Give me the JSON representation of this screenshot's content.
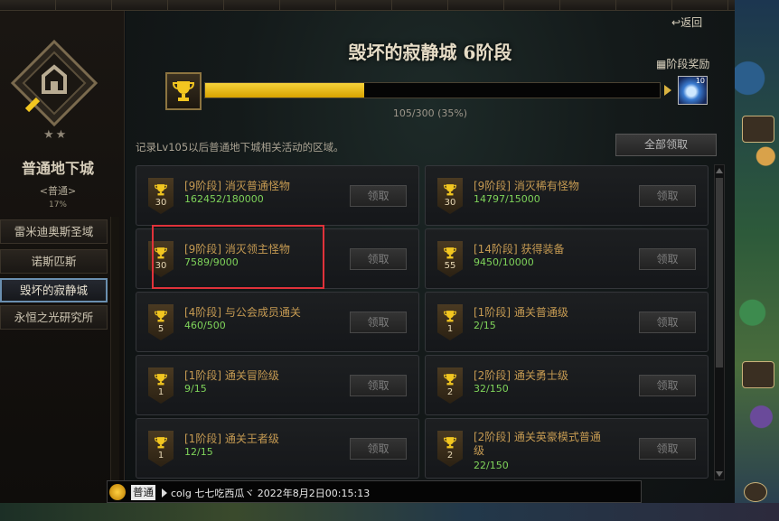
{
  "panel": {
    "back_label": "返回",
    "stage_title": "毁坏的寂静城 6阶段",
    "stage_reward_label": "阶段奖励",
    "progress": {
      "current": 105,
      "total": 300,
      "fraction": 0.35,
      "text": "105/300 (35%)"
    },
    "reward_count": "10",
    "description": "记录Lv105以后普通地下城相关活动的区域。",
    "claim_all_label": "全部领取"
  },
  "left": {
    "dungeon_title": "普通地下城",
    "difficulty": "<普通>",
    "percent": "17%",
    "areas": [
      {
        "label": "雷米迪奥斯圣域"
      },
      {
        "label": "诺斯匹斯"
      },
      {
        "label": "毁坏的寂静城",
        "active": true
      },
      {
        "label": "永恒之光研究所"
      }
    ]
  },
  "achievements": [
    {
      "title": "[9阶段] 消灭普通怪物",
      "progress": "162452/180000",
      "badge": "30",
      "claim": "领取"
    },
    {
      "title": "[9阶段] 消灭稀有怪物",
      "progress": "14797/15000",
      "badge": "30",
      "claim": "领取"
    },
    {
      "title": "[9阶段] 消灭领主怪物",
      "progress": "7589/9000",
      "badge": "30",
      "claim": "领取"
    },
    {
      "title": "[14阶段] 获得装备",
      "progress": "9450/10000",
      "badge": "55",
      "claim": "领取"
    },
    {
      "title": "[4阶段] 与公会成员通关",
      "progress": "460/500",
      "badge": "5",
      "claim": "领取"
    },
    {
      "title": "[1阶段] 通关普通级",
      "progress": "2/15",
      "badge": "1",
      "claim": "领取"
    },
    {
      "title": "[1阶段] 通关冒险级",
      "progress": "9/15",
      "badge": "1",
      "claim": "领取"
    },
    {
      "title": "[2阶段] 通关勇士级",
      "progress": "32/150",
      "badge": "2",
      "claim": "领取"
    },
    {
      "title": "[1阶段] 通关王者级",
      "progress": "12/15",
      "badge": "1",
      "claim": "领取"
    },
    {
      "title": "[2阶段] 通关英豪模式普通",
      "title2": "级",
      "progress": "22/150",
      "badge": "2",
      "claim": "领取"
    }
  ],
  "chat": {
    "channel": "普通",
    "text": "colg 七七吃西瓜ヾ 2022年8月2日00:15:13"
  },
  "colors": {
    "accent_gold": "#f2c620",
    "progress_green": "#7fd45a",
    "title_orange": "#c59a52",
    "highlight_red": "#e0323a"
  }
}
